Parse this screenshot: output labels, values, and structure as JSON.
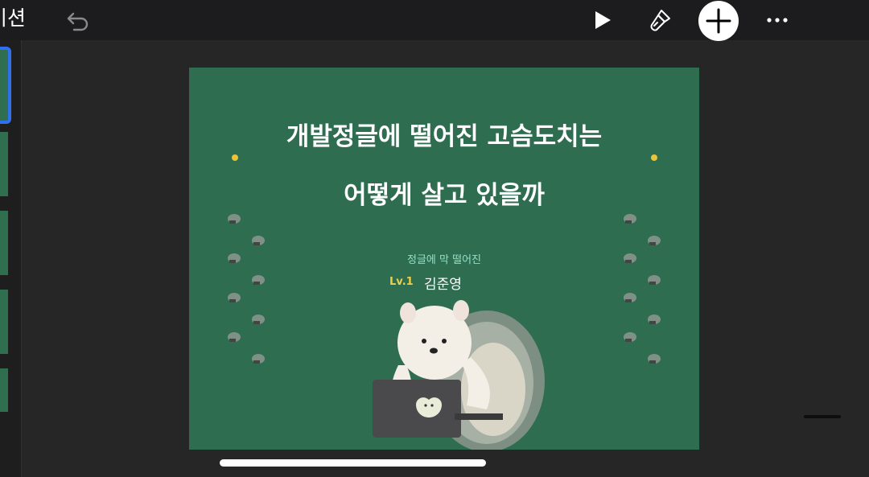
{
  "toolbar": {
    "title": "이션",
    "icons": [
      "undo-icon",
      "play-icon",
      "format-brush-icon",
      "add-icon",
      "more-icon"
    ]
  },
  "slide": {
    "title_line1": "개발정글에 떨어진 고슴도치는",
    "title_line2": "어떻게 살고 있을까",
    "subtitle": "정글에 막 떨어진",
    "level": "Lv.1",
    "name": "김준영"
  },
  "colors": {
    "slide_background": "#2f6d51",
    "accent_yellow": "#e9c33a",
    "subtitle_mint": "#8fe0c8",
    "selection_blue": "#2f6ff0"
  }
}
